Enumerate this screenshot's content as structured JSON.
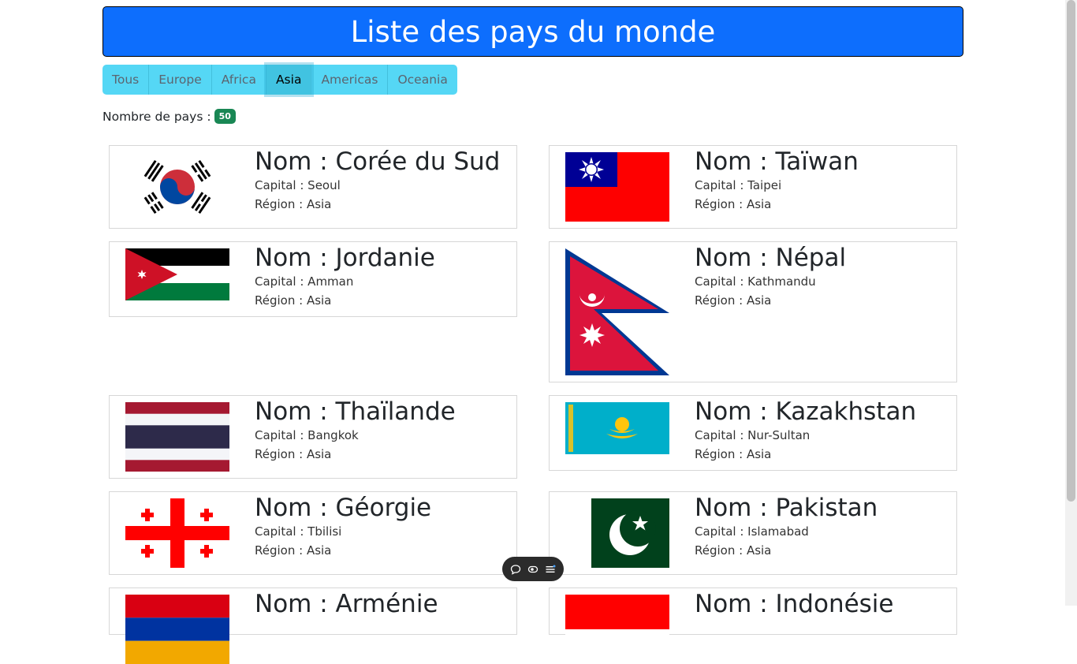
{
  "header": {
    "title": "Liste des pays du monde"
  },
  "filters": [
    {
      "label": "Tous",
      "active": false
    },
    {
      "label": "Europe",
      "active": false
    },
    {
      "label": "Africa",
      "active": false
    },
    {
      "label": "Asia",
      "active": true
    },
    {
      "label": "Americas",
      "active": false
    },
    {
      "label": "Oceania",
      "active": false
    }
  ],
  "count": {
    "label": "Nombre de pays :",
    "value": "50"
  },
  "cards": [
    {
      "name": "Nom : Corée du Sud",
      "capital": "Capital : Seoul",
      "region": "Région : Asia",
      "flag_icon": "south-korea-flag"
    },
    {
      "name": "Nom : Taïwan",
      "capital": "Capital : Taipei",
      "region": "Région : Asia",
      "flag_icon": "taiwan-flag"
    },
    {
      "name": "Nom : Jordanie",
      "capital": "Capital : Amman",
      "region": "Région : Asia",
      "flag_icon": "jordan-flag"
    },
    {
      "name": "Nom : Népal",
      "capital": "Capital : Kathmandu",
      "region": "Région : Asia",
      "flag_icon": "nepal-flag"
    },
    {
      "name": "Nom : Thaïlande",
      "capital": "Capital : Bangkok",
      "region": "Région : Asia",
      "flag_icon": "thailand-flag"
    },
    {
      "name": "Nom : Kazakhstan",
      "capital": "Capital : Nur-Sultan",
      "region": "Région : Asia",
      "flag_icon": "kazakhstan-flag"
    },
    {
      "name": "Nom : Géorgie",
      "capital": "Capital : Tbilisi",
      "region": "Région : Asia",
      "flag_icon": "georgia-flag"
    },
    {
      "name": "Nom : Pakistan",
      "capital": "Capital : Islamabad",
      "region": "Région : Asia",
      "flag_icon": "pakistan-flag"
    },
    {
      "name": "Nom : Arménie",
      "flag_icon": "armenia-flag"
    },
    {
      "name": "Nom : Indonésie",
      "flag_icon": "indonesia-flag"
    }
  ],
  "toolbar": {
    "icons": [
      "chat-icon",
      "eye-icon",
      "menu-icon"
    ]
  },
  "colors": {
    "title_bg": "#0d6efd",
    "filter_bg": "#55d7f5",
    "badge_bg": "#198754"
  }
}
